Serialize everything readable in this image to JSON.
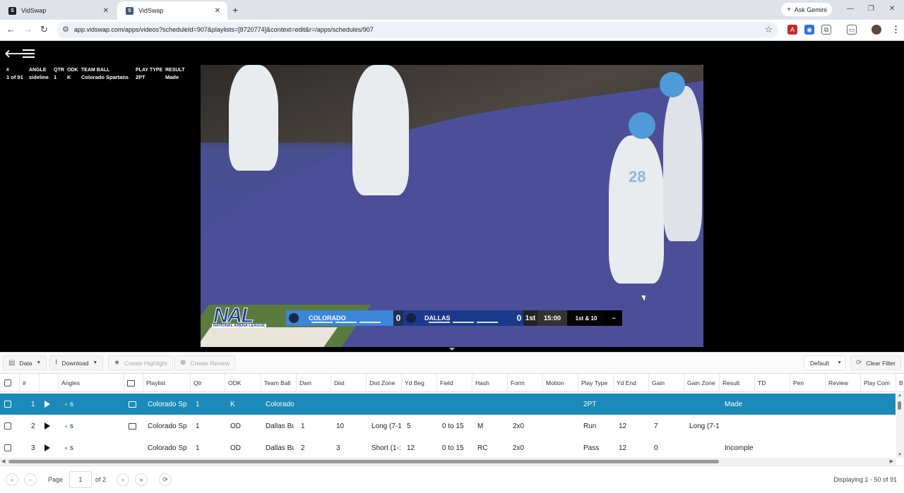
{
  "browser": {
    "tabs": [
      {
        "title": "VidSwap",
        "active": false
      },
      {
        "title": "VidSwap",
        "active": true
      }
    ],
    "url": "app.vidswap.com/apps/videos?scheduleId=907&playlists=[8720774]&context=edit&r=/apps/schedules/907",
    "gemini_label": "Ask Gemini"
  },
  "overlay_info": {
    "headers": [
      "#",
      "ANGLE",
      "QTR",
      "ODK",
      "TEAM BALL",
      "PLAY TYPE",
      "RESULT"
    ],
    "values": [
      "1 of 91",
      "sideline",
      "1",
      "K",
      "Colorado Spartans",
      "2PT",
      "Made"
    ]
  },
  "scorebug": {
    "logo": "NAL",
    "logo_sub": "NATIONAL ARENA LEAGUE",
    "home": "COLORADO",
    "home_score": "0",
    "away": "DALLAS",
    "away_score": "0",
    "quarter": "1st",
    "clock": "15:00",
    "down": "1st & 10"
  },
  "video_jersey": "28",
  "toolbar": {
    "data": "Data",
    "download": "Download",
    "create_highlight": "Create Highlight",
    "create_review": "Create Review",
    "default": "Default",
    "clear_filter": "Clear Filter"
  },
  "table": {
    "columns": [
      "#",
      "Angles",
      "Playlist",
      "Qtr",
      "ODK",
      "Team Ball",
      "Dwn",
      "Dist",
      "Dist Zone",
      "Yd Beg",
      "Field",
      "Hash",
      "Form",
      "Motion",
      "Play Type",
      "Yd End",
      "Gain",
      "Gain Zone",
      "Result",
      "TD",
      "Pen",
      "Review",
      "Play Com",
      "B"
    ],
    "rows": [
      {
        "num": "1",
        "angle": "s",
        "has_image": true,
        "playlist": "Colorado Sp",
        "qtr": "1",
        "odk": "K",
        "team_ball": "Colorado",
        "dwn": "",
        "dist": "",
        "dist_zone": "",
        "yd_beg": "",
        "field": "",
        "hash": "",
        "form": "",
        "motion": "",
        "play_type": "2PT",
        "yd_end": "",
        "gain": "",
        "gain_zone": "",
        "result": "Made",
        "selected": true
      },
      {
        "num": "2",
        "angle": "s",
        "has_image": true,
        "playlist": "Colorado Sp",
        "qtr": "1",
        "odk": "OD",
        "team_ball": "Dallas Bu",
        "dwn": "1",
        "dist": "10",
        "dist_zone": "Long (7-1",
        "yd_beg": "5",
        "field": "0 to 15",
        "hash": "M",
        "form": "2x0",
        "motion": "",
        "play_type": "Run",
        "yd_end": "12",
        "gain": "7",
        "gain_zone": "Long (7-1",
        "result": "",
        "selected": false
      },
      {
        "num": "3",
        "angle": "s",
        "has_image": false,
        "playlist": "Colorado Sp",
        "qtr": "1",
        "odk": "OD",
        "team_ball": "Dallas Bu",
        "dwn": "2",
        "dist": "3",
        "dist_zone": "Short (1-:",
        "yd_beg": "12",
        "field": "0 to 15",
        "hash": "RC",
        "form": "2x0",
        "motion": "",
        "play_type": "Pass",
        "yd_end": "12",
        "gain": "0",
        "gain_zone": "",
        "result": "Incomple",
        "selected": false
      }
    ]
  },
  "pager": {
    "page_label": "Page",
    "page": "1",
    "of": "of 2",
    "displaying": "Displaying 1 - 50 of 91"
  },
  "colors": {
    "selected_row": "#1b8ab8",
    "home_team": "#3c86d8",
    "away_team": "#1b3a8c"
  }
}
